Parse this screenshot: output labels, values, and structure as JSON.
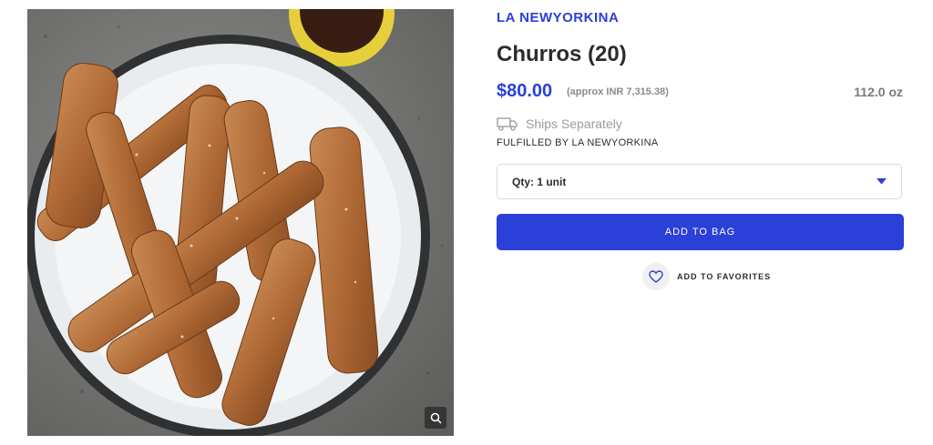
{
  "product": {
    "brand": "LA NEWYORKINA",
    "title": "Churros (20)",
    "price": "$80.00",
    "approx_price": "(approx INR 7,315.38)",
    "weight": "112.0 oz",
    "shipping_label": "Ships Separately",
    "fulfilled_by": "FULFILLED BY LA NEWYORKINA",
    "quantity_label": "Qty: 1 unit",
    "add_to_bag_label": "ADD TO BAG",
    "add_to_favorites_label": "ADD TO FAVORITES",
    "image_subject": "plate of sugar-coated churros with chocolate dipping sauce on a stone surface"
  },
  "icons": {
    "shipping": "truck-icon",
    "quantity": "caret-down-icon",
    "favorites": "heart-icon",
    "zoom": "magnifier-icon"
  },
  "colors": {
    "accent": "#2b3fd9",
    "text_dark": "#2c2c2c",
    "muted": "#9a9a9a"
  }
}
